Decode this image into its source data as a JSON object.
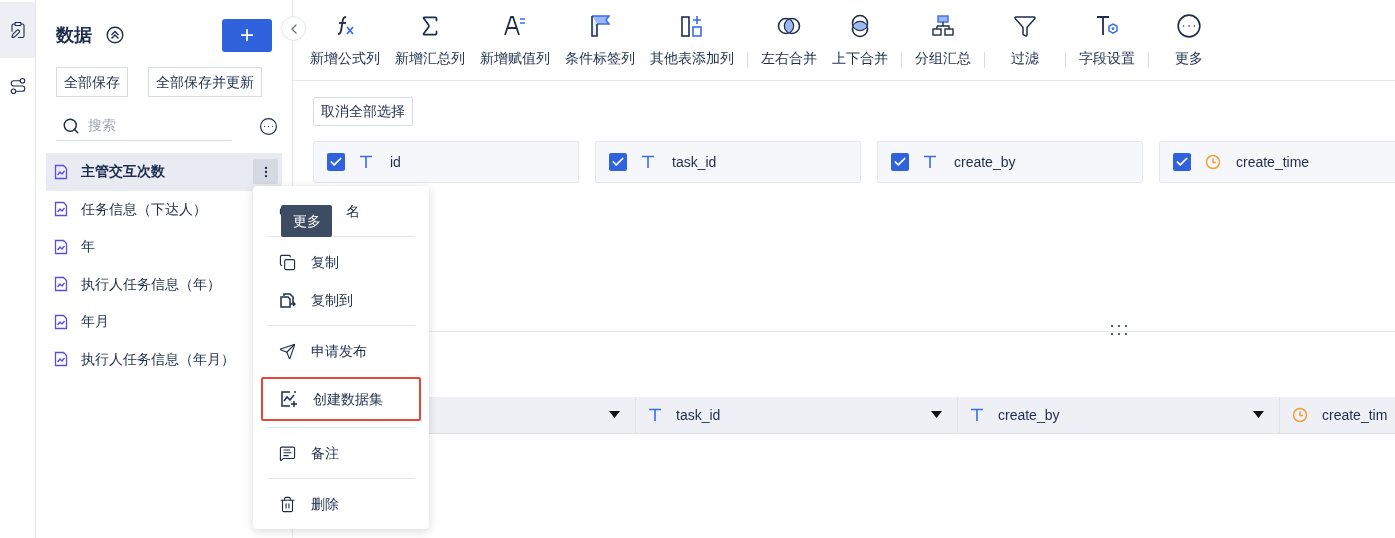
{
  "rail": [
    {
      "kind": "clipboard",
      "selected": true
    },
    {
      "kind": "route",
      "selected": false
    }
  ],
  "sidebar": {
    "title": "数据",
    "add_button": "+",
    "buttons": [
      "全部保存",
      "全部保存并更新"
    ],
    "search": {
      "placeholder": "搜索"
    },
    "items": [
      {
        "label": "主管交互次数",
        "selected": true
      },
      {
        "label": "任务信息（下达人）",
        "selected": false
      },
      {
        "label": "年",
        "selected": false
      },
      {
        "label": "执行人任务信息（年）",
        "selected": false
      },
      {
        "label": "年月",
        "selected": false
      },
      {
        "label": "执行人任务信息（年月）",
        "selected": false
      }
    ]
  },
  "toolbar": {
    "groups": [
      [
        {
          "kind": "formula",
          "label": "新增公式列"
        },
        {
          "kind": "sum",
          "label": "新增汇总列"
        },
        {
          "kind": "assign",
          "label": "新增赋值列"
        },
        {
          "kind": "flag",
          "label": "条件标签列"
        },
        {
          "kind": "addcol",
          "label": "其他表添加列"
        }
      ],
      [
        {
          "kind": "lr",
          "label": "左右合并"
        },
        {
          "kind": "ud",
          "label": "上下合并"
        }
      ],
      [
        {
          "kind": "group",
          "label": "分组汇总"
        }
      ],
      [
        {
          "kind": "filter",
          "label": "过滤"
        }
      ],
      [
        {
          "kind": "fieldset",
          "label": "字段设置"
        }
      ],
      [
        {
          "kind": "more",
          "label": "更多"
        }
      ]
    ]
  },
  "deselect_button": "取消全部选择",
  "fields": [
    {
      "name": "id",
      "kind": "text",
      "checked": true
    },
    {
      "name": "task_id",
      "kind": "text",
      "checked": true
    },
    {
      "name": "create_by",
      "kind": "text",
      "checked": true
    },
    {
      "name": "create_time",
      "kind": "time",
      "checked": true
    }
  ],
  "table": {
    "columns": [
      {},
      {
        "name": "task_id",
        "kind": "text"
      },
      {
        "name": "create_by",
        "kind": "text"
      },
      {
        "name": "create_tim",
        "kind": "time"
      }
    ]
  },
  "menu": {
    "groups": [
      [
        {
          "kind": "rename",
          "label": "名",
          "highlighted": false
        }
      ],
      [
        {
          "kind": "copy",
          "label": "复制",
          "highlighted": false
        },
        {
          "kind": "copyto",
          "label": "复制到",
          "highlighted": false
        }
      ],
      [
        {
          "kind": "publish",
          "label": "申请发布",
          "highlighted": false
        },
        {
          "kind": "dataset",
          "label": "创建数据集",
          "highlighted": true
        }
      ],
      [
        {
          "kind": "note",
          "label": "备注",
          "highlighted": false
        }
      ],
      [
        {
          "kind": "delete",
          "label": "删除",
          "highlighted": false
        }
      ]
    ]
  },
  "tooltip": "更多"
}
